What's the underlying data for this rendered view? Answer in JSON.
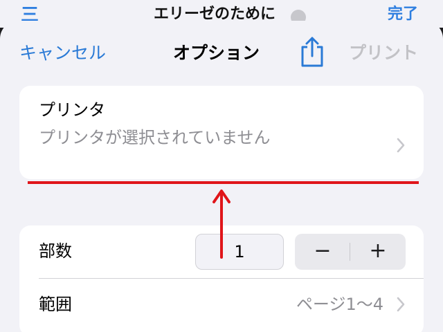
{
  "behind": {
    "left_glyph": "三",
    "title": "エリーゼのために",
    "right": "完了"
  },
  "nav": {
    "cancel": "キャンセル",
    "title": "オプション",
    "print": "プリント",
    "share_icon": "share-icon"
  },
  "printer": {
    "label": "プリンタ",
    "status": "プリンタが選択されていません"
  },
  "copies": {
    "label": "部数",
    "value": "1",
    "decrement": "−",
    "increment": "+"
  },
  "range": {
    "label": "範囲",
    "value": "ページ1〜4"
  },
  "colors": {
    "accent": "#2a7ad6",
    "annotation": "#e0151a",
    "disabled": "#c2c2c6",
    "secondary_text": "#8e8e93"
  }
}
